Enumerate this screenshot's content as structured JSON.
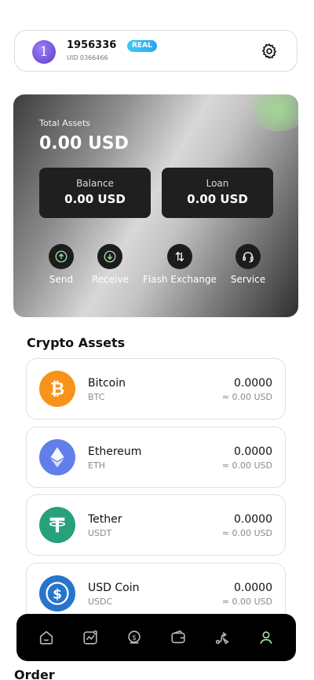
{
  "user": {
    "avatar_level": "1",
    "id": "1956336",
    "badge": "REAL",
    "uid": "UID 0366466"
  },
  "assets": {
    "total_label": "Total Assets",
    "total_value": "0.00 USD",
    "balance_label": "Balance",
    "balance_value": "0.00 USD",
    "loan_label": "Loan",
    "loan_value": "0.00 USD"
  },
  "actions": [
    {
      "label": "Send",
      "icon": "arrow-up-circle-icon"
    },
    {
      "label": "Receive",
      "icon": "arrow-down-circle-icon"
    },
    {
      "label": "Flash Exchange",
      "icon": "swap-arrows-icon"
    },
    {
      "label": "Service",
      "icon": "headset-icon"
    }
  ],
  "crypto_title": "Crypto Assets",
  "coins": [
    {
      "name": "Bitcoin",
      "symbol": "BTC",
      "amount": "0.0000",
      "value": "≈ 0.00 USD",
      "color": "#f7931a"
    },
    {
      "name": "Ethereum",
      "symbol": "ETH",
      "amount": "0.0000",
      "value": "≈ 0.00 USD",
      "color": "#627eea"
    },
    {
      "name": "Tether",
      "symbol": "USDT",
      "amount": "0.0000",
      "value": "≈ 0.00 USD",
      "color": "#26a17b"
    },
    {
      "name": "USD Coin",
      "symbol": "USDC",
      "amount": "0.0000",
      "value": "≈ 0.00 USD",
      "color": "#2775ca"
    }
  ],
  "order_title": "Order",
  "nav": [
    {
      "icon": "home-icon"
    },
    {
      "icon": "chart-icon"
    },
    {
      "icon": "dollar-icon"
    },
    {
      "icon": "wallet-icon"
    },
    {
      "icon": "route-icon"
    },
    {
      "icon": "profile-icon",
      "active": true
    }
  ],
  "colors": {
    "accent_green": "#9de0a0",
    "badge": "#3ec9f3"
  }
}
